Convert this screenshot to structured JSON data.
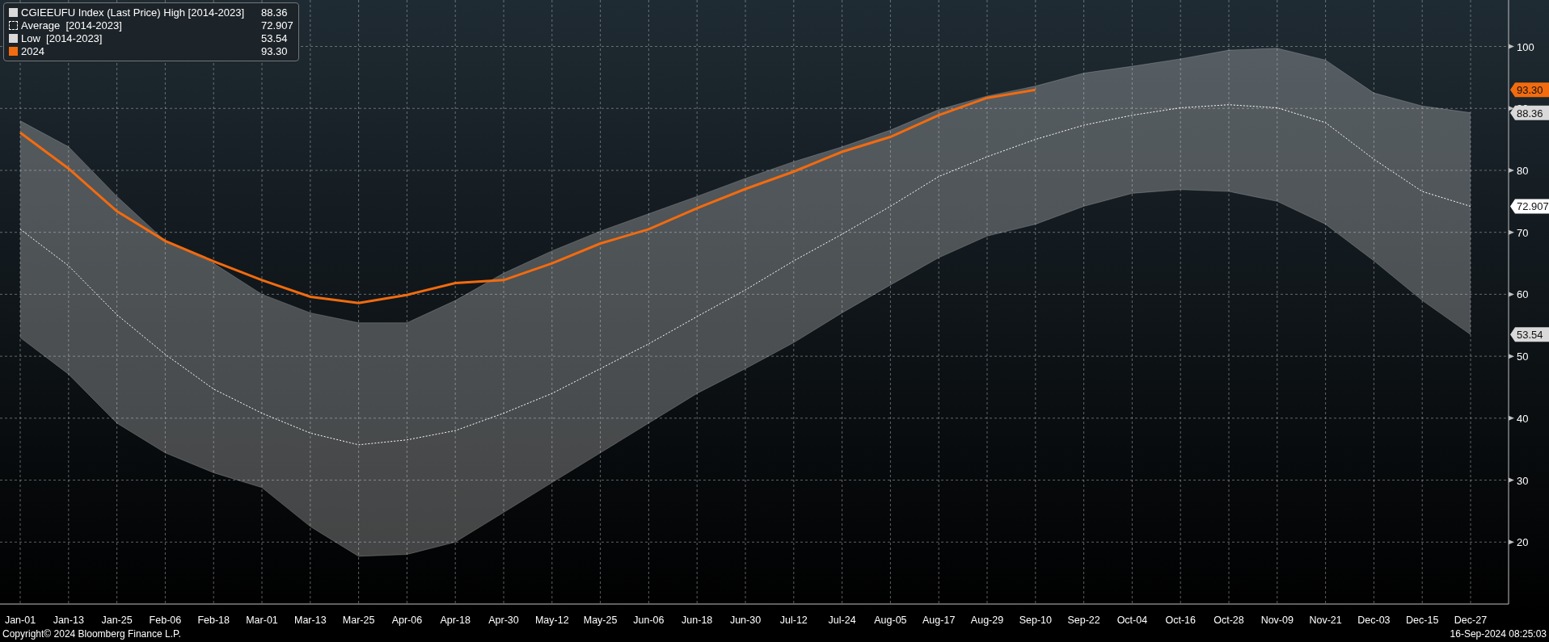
{
  "chart_data": {
    "type": "line",
    "categories": [
      "Jan-01",
      "Jan-13",
      "Jan-25",
      "Feb-06",
      "Feb-18",
      "Mar-01",
      "Mar-13",
      "Mar-25",
      "Apr-06",
      "Apr-18",
      "Apr-30",
      "May-12",
      "May-25",
      "Jun-06",
      "Jun-18",
      "Jun-30",
      "Jul-12",
      "Jul-24",
      "Aug-05",
      "Aug-17",
      "Aug-29",
      "Sep-10",
      "Sep-22",
      "Oct-04",
      "Oct-16",
      "Oct-28",
      "Nov-09",
      "Nov-21",
      "Dec-03",
      "Dec-15",
      "Dec-27"
    ],
    "ylim": [
      10,
      107.5
    ],
    "yticks": [
      20,
      30,
      40,
      50,
      60,
      70,
      80,
      90,
      100
    ],
    "grid": true,
    "legend": true,
    "series": [
      {
        "name": "CGIEEUFU Index (Last Price) High [2014-2023]",
        "color": "#d9d9d9",
        "type": "area",
        "values": [
          88,
          83.8,
          75.8,
          68.6,
          65,
          60,
          57,
          55.4,
          55.4,
          59,
          63.4,
          67,
          70.2,
          73,
          75.8,
          78.7,
          81.4,
          83.8,
          86.5,
          89.8,
          92,
          93.6,
          95.7,
          96.8,
          98,
          99.4,
          99.7,
          97.8,
          92.5,
          90.4,
          89.3
        ]
      },
      {
        "name": "Average  [2014-2023]",
        "color": "#ffffff",
        "line_style": "dotted",
        "values": [
          70.5,
          64.6,
          56.7,
          50.3,
          44.7,
          40.8,
          37.6,
          35.7,
          36.5,
          38,
          40.8,
          44,
          48,
          52,
          56.4,
          60.7,
          65.4,
          69.7,
          74.2,
          79,
          82.2,
          85,
          87.3,
          88.9,
          90.1,
          90.6,
          90.1,
          87.7,
          81.8,
          76.6,
          74.2
        ]
      },
      {
        "name": "Low  [2014-2023]",
        "color": "#d9d9d9",
        "values": [
          53,
          47.1,
          39.2,
          34.4,
          31.2,
          28.8,
          22.5,
          17.7,
          18,
          20,
          24.8,
          29.6,
          34.4,
          39.2,
          44,
          48,
          52.2,
          57,
          61.5,
          65.9,
          69.4,
          71.3,
          74.2,
          76.3,
          76.9,
          76.6,
          75,
          71.3,
          65.4,
          59,
          53.5
        ]
      },
      {
        "name": "2024",
        "color": "#f26b0f",
        "values": [
          86.1,
          80.3,
          73.4,
          68.6,
          65.3,
          62.3,
          59.6,
          58.6,
          59.9,
          61.8,
          62.3,
          65,
          68.2,
          70.5,
          73.9,
          77,
          79.8,
          83,
          85.4,
          88.9,
          91.7,
          93.0,
          null,
          null,
          null,
          null,
          null,
          null,
          null,
          null,
          null
        ]
      }
    ]
  },
  "legend": [
    {
      "kind": "band",
      "value": "88.36"
    },
    {
      "kind": "dotted",
      "value": "72.907"
    },
    {
      "kind": "band",
      "value": "53.54"
    },
    {
      "kind": "line",
      "value": "93.30"
    }
  ],
  "value_tags": [
    {
      "text": "93.30",
      "color": "#f26b0f"
    },
    {
      "text": "88.36",
      "color": "#d9d9d9"
    },
    {
      "text": "72.907",
      "color": "#ffffff"
    },
    {
      "text": "53.54",
      "color": "#d9d9d9"
    }
  ],
  "footer": {
    "copyright": "Copyright© 2024 Bloomberg Finance L.P.",
    "timestamp": "16-Sep-2024 08:25:03"
  }
}
